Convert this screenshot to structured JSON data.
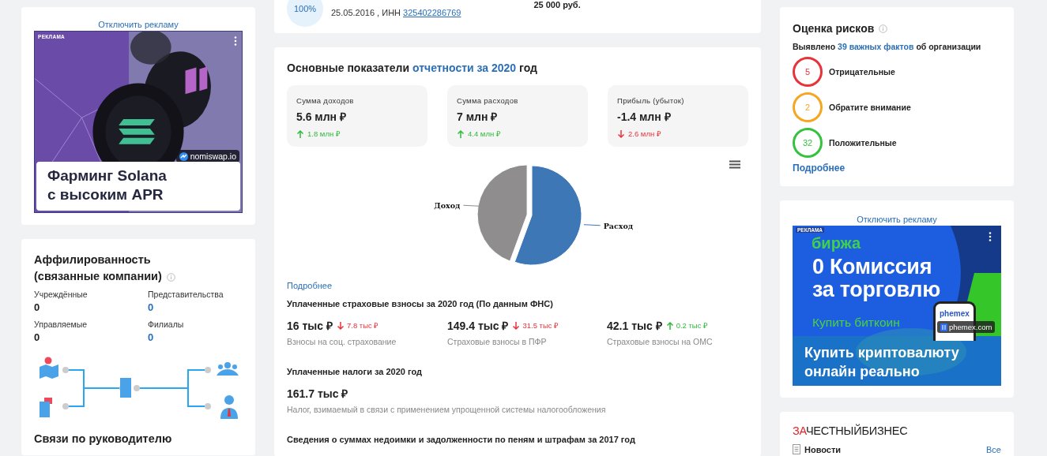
{
  "left_ad": {
    "disable_link": "Отключить рекламу",
    "badge": "РЕКЛАМА",
    "source": "nomiswap.io",
    "headline": "Фарминг Solana\nс высоким APR"
  },
  "affiliation": {
    "title": "Аффилированность\n(связанные компании)",
    "counters": [
      {
        "label": "Учреждённые",
        "value": "0",
        "link": false
      },
      {
        "label": "Представительства",
        "value": "0",
        "link": true
      },
      {
        "label": "Управляемые",
        "value": "0",
        "link": false
      },
      {
        "label": "Филиалы",
        "value": "0",
        "link": true
      }
    ],
    "next_title": "Связи по руководителю"
  },
  "company": {
    "share": "100%",
    "details": "25.05.2016 , ИНН",
    "inn": "325402286769",
    "capital": "25 000 руб."
  },
  "report": {
    "title_start": "Основные показатели",
    "title_link": "отчетности за 2020",
    "title_end": "год",
    "metrics": [
      {
        "label": "Сумма доходов",
        "value": "5.6 млн ₽",
        "change": "1.8 млн ₽",
        "increase": true
      },
      {
        "label": "Сумма расходов",
        "value": "7 млн ₽",
        "change": "4.4 млн ₽",
        "increase": true
      },
      {
        "label": "Прибыль (убыток)",
        "value": "-1.4 млн ₽",
        "change": "2.6 млн ₽",
        "increase": false
      }
    ],
    "chart_data": {
      "type": "pie",
      "categories": [
        "Доход",
        "Расход"
      ],
      "values": [
        44.4,
        55.6
      ],
      "colors": [
        "#8f8d8d",
        "#3d77b5"
      ]
    },
    "more_link": "Подробнее",
    "insurance_title": "Уплаченные страховые взносы за 2020 год (По данным ФНС)",
    "insurance": [
      {
        "value": "16 тыс ₽",
        "change": "7.8 тыс ₽",
        "increase": false,
        "caption": "Взносы на соц. страхование"
      },
      {
        "value": "149.4 тыс ₽",
        "change": "31.5 тыс ₽",
        "increase": false,
        "caption": "Страховые взносы в ПФР"
      },
      {
        "value": "42.1 тыс ₽",
        "change": "0.2 тыс ₽",
        "increase": true,
        "caption": "Страховые взносы на ОМС"
      }
    ],
    "taxes_title": "Уплаченные налоги за 2020 год",
    "tax_value": "161.7 тыс ₽",
    "tax_caption": "Налог, взимаемый в связи с применением упрощенной системы налогообложения",
    "arrears_title": "Сведения о суммах недоимки и задолженности по пеням и штрафам за 2017 год"
  },
  "risks": {
    "title": "Оценка рисков",
    "summary_start": "Выявлено",
    "facts_link": "39 важных фактов",
    "summary_end": "об организации",
    "items": [
      {
        "count": "5",
        "label": "Отрицательные",
        "color": "#e8333b"
      },
      {
        "count": "2",
        "label": "Обратите внимание",
        "color": "#f5a623"
      },
      {
        "count": "32",
        "label": "Положительные",
        "color": "#35c23f"
      }
    ],
    "more_link": "Подробнее"
  },
  "right_ad": {
    "disable_link": "Отключить рекламу",
    "badge": "РЕКЛАМА",
    "brand": "биржа",
    "headline": "0 Комиссия\nза торговлю",
    "cta": "Купить биткоин",
    "app_name": "phemex",
    "site": "phemex.com",
    "footer": "Купить криптовалюту\nонлайн реально"
  },
  "news": {
    "logo_accent": "ЗА",
    "logo_rest": "ЧЕСТНЫЙБИЗНЕС",
    "section": "Новости",
    "all_link": "Все"
  }
}
